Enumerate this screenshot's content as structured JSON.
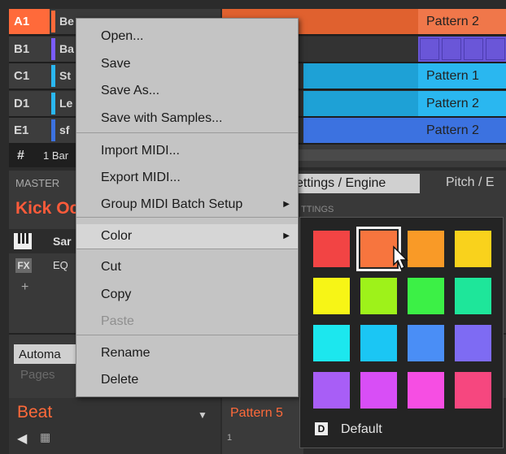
{
  "groups": [
    {
      "id": "A1",
      "name": "Be",
      "color": "#ff6a3a",
      "clip": "#ff6a3a",
      "pattern": "Pattern 2",
      "clipColor": "#e0612f",
      "labelColor": "#f0774a"
    },
    {
      "id": "B1",
      "name": "Ba",
      "color": "#7a5cff",
      "clip": "#6a56d8",
      "pattern": "",
      "clipColor": "#6a56d8",
      "labelColor": "#6a56d8"
    },
    {
      "id": "C1",
      "name": "St",
      "color": "#2ab7f0",
      "clip": "#2ab7f0",
      "pattern": "Pattern 1",
      "clipColor": "#1ea1d6",
      "labelColor": "#2ab7f0"
    },
    {
      "id": "D1",
      "name": "Le",
      "color": "#2ab7f0",
      "clip": "#2ab7f0",
      "pattern": "Pattern 2",
      "clipColor": "#1ea1d6",
      "labelColor": "#2ab7f0"
    },
    {
      "id": "E1",
      "name": "sf",
      "color": "#3c72e0",
      "clip": "#3c72e0",
      "pattern": "Pattern 2",
      "clipColor": "#3c72e0",
      "labelColor": "#3c72e0"
    }
  ],
  "bar_row": {
    "hash": "#",
    "label": "1 Bar"
  },
  "master": {
    "label": "MASTER",
    "sound_name": "Kick Oc",
    "tab_settings": "ettings / Engine",
    "tab_pitch": "Pitch / E",
    "settings_partial": "TTINGS"
  },
  "plugin_rows": [
    {
      "icon": "keys-icon",
      "label": "Sar"
    },
    {
      "icon": "fx-icon",
      "icon_text": "FX",
      "label": "EQ"
    }
  ],
  "plus": "+",
  "automation": {
    "label": "Automa",
    "pages": "Pages"
  },
  "beat": {
    "label": "Beat",
    "pattern": "Pattern 5",
    "row_num": "1"
  },
  "menu": {
    "items": [
      {
        "label": "Open...",
        "enabled": true,
        "submenu": false
      },
      {
        "label": "Save",
        "enabled": true,
        "submenu": false
      },
      {
        "label": "Save As...",
        "enabled": true,
        "submenu": false
      },
      {
        "label": "Save with Samples...",
        "enabled": true,
        "submenu": false
      },
      {
        "label": "Import MIDI...",
        "enabled": true,
        "submenu": false
      },
      {
        "label": "Export MIDI...",
        "enabled": true,
        "submenu": false
      },
      {
        "label": "Group MIDI Batch Setup",
        "enabled": true,
        "submenu": true
      },
      {
        "label": "Color",
        "enabled": true,
        "submenu": true
      },
      {
        "label": "Cut",
        "enabled": true,
        "submenu": false
      },
      {
        "label": "Copy",
        "enabled": true,
        "submenu": false
      },
      {
        "label": "Paste",
        "enabled": false,
        "submenu": false
      },
      {
        "label": "Rename",
        "enabled": true,
        "submenu": false
      },
      {
        "label": "Delete",
        "enabled": true,
        "submenu": false
      }
    ]
  },
  "palette": {
    "colors": [
      "#f24444",
      "#f7753e",
      "#f99a27",
      "#f9d21c",
      "#f7f516",
      "#9ef21a",
      "#3cf046",
      "#1ee69a",
      "#1ce7ee",
      "#1bc6f4",
      "#4a8ef6",
      "#7e6bf3",
      "#a85ef6",
      "#d84ef6",
      "#f64ee3",
      "#f6477f"
    ],
    "selected_index": 1,
    "default_key": "D",
    "default_label": "Default"
  }
}
